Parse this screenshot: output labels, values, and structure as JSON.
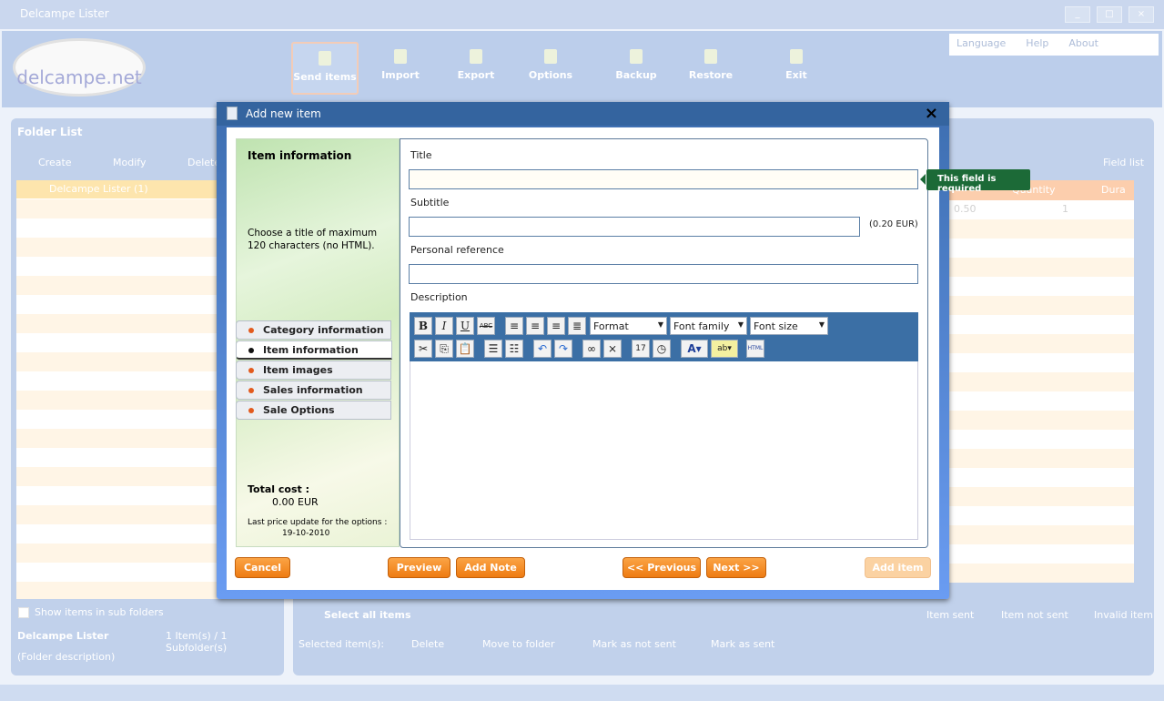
{
  "window": {
    "title": "Delcampe Lister",
    "controls": [
      "_",
      "□",
      "×"
    ]
  },
  "logo": {
    "text": "delcampe.net"
  },
  "toolbar": [
    {
      "label": "Send items",
      "icon": "send-items-icon"
    },
    {
      "label": "Import",
      "icon": "import-icon"
    },
    {
      "label": "Export",
      "icon": "export-icon"
    },
    {
      "label": "Options",
      "icon": "wrench-icon"
    },
    {
      "label": "Backup",
      "icon": "backup-icon"
    },
    {
      "label": "Restore",
      "icon": "restore-icon"
    },
    {
      "label": "Exit",
      "icon": "exit-icon"
    }
  ],
  "helpbar": {
    "language": "Language",
    "help": "Help",
    "about": "About"
  },
  "folders": {
    "title": "Folder List",
    "create": "Create",
    "modify": "Modify",
    "delete": "Delete",
    "tree_item": "Delcampe Lister (1)",
    "show_sub": "Show items in sub folders",
    "folder_name": "Delcampe Lister",
    "folder_count": "1 Item(s) / 1 Subfolder(s)",
    "folder_desc": "(Folder description)"
  },
  "items": {
    "field_list": "Field list",
    "columns": [
      "Quantity",
      "Dura"
    ],
    "row1": {
      "price": "0.50",
      "quantity": "1"
    },
    "select_all": "Select all items",
    "legend": {
      "sent": "Item sent",
      "not_sent": "Item not sent",
      "invalid": "Invalid item"
    },
    "selected_label": "Selected item(s):",
    "actions": [
      "Delete",
      "Move to folder",
      "Mark as not sent",
      "Mark as sent"
    ]
  },
  "dialog": {
    "title": "Add new item",
    "close": "×",
    "side": {
      "heading": "Item information",
      "hint": "Choose a title of maximum 120 characters (no HTML).",
      "tabs": [
        "Category information",
        "Item information",
        "Item images",
        "Sales information",
        "Sale Options"
      ],
      "active_tab": 1,
      "total_label": "Total cost :",
      "total_value": "0.00 EUR",
      "update_label": "Last price update for the options :",
      "update_date": "19-10-2010"
    },
    "form": {
      "title_label": "Title",
      "title_value": "",
      "subtitle_label": "Subtitle",
      "subtitle_value": "",
      "subtitle_cost": "(0.20 EUR)",
      "ref_label": "Personal reference",
      "ref_value": "",
      "desc_label": "Description",
      "format": "Format",
      "font_family": "Font family",
      "font_size": "Font size",
      "html": "HTML"
    },
    "tooltip": "This field is required",
    "buttons": {
      "cancel": "Cancel",
      "preview": "Preview",
      "add_note": "Add Note",
      "previous": "<< Previous",
      "next": "Next >>",
      "add_item": "Add item"
    }
  }
}
